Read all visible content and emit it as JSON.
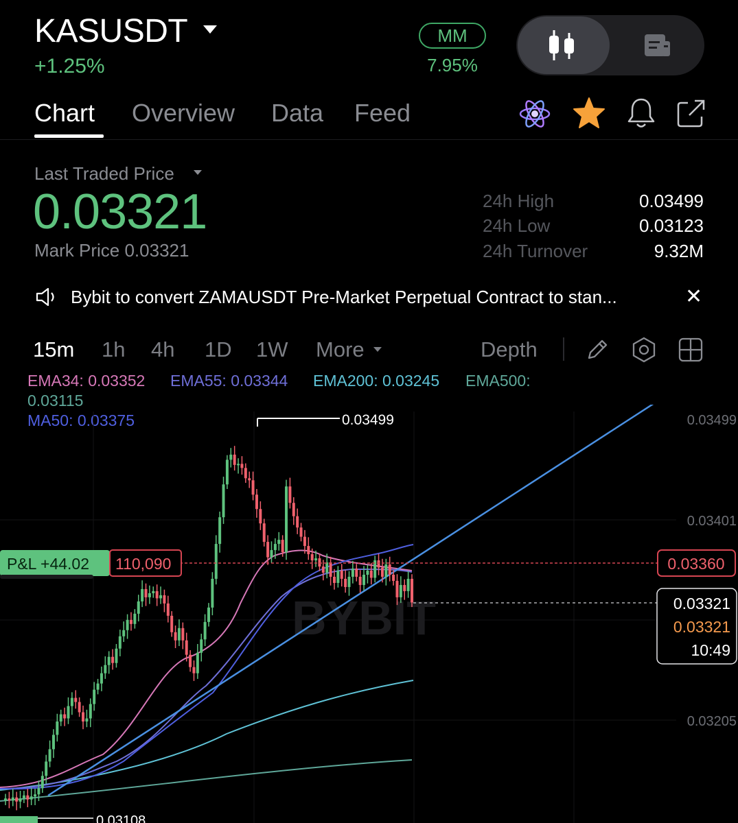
{
  "header": {
    "symbol": "KASUSDT",
    "change": "+1.25%",
    "mm_badge": "MM",
    "mm_value": "7.95%"
  },
  "tabs": [
    {
      "label": "Chart",
      "active": true
    },
    {
      "label": "Overview"
    },
    {
      "label": "Data"
    },
    {
      "label": "Feed"
    }
  ],
  "price": {
    "last_label": "Last Traded Price",
    "last": "0.03321",
    "mark": "Mark Price 0.03321",
    "stats": [
      {
        "label": "24h High",
        "value": "0.03499"
      },
      {
        "label": "24h Low",
        "value": "0.03123"
      },
      {
        "label": "24h Turnover",
        "value": "9.32M"
      }
    ]
  },
  "announcement": {
    "text": "Bybit to convert ZAMAUSDT Pre-Market Perpetual Contract to stan..."
  },
  "intervals": {
    "items": [
      "15m",
      "1h",
      "4h",
      "1D",
      "1W"
    ],
    "more": "More",
    "depth": "Depth"
  },
  "indicators": {
    "ema34": "EMA34: 0.03352",
    "ema55": "EMA55: 0.03344",
    "ema200": "EMA200: 0.03245",
    "ema500_label": "EMA500:",
    "ema500_value": "0.03115",
    "ma50": "MA50: 0.03375"
  },
  "colors": {
    "up": "#5ec27e",
    "down": "#f0616d",
    "ema34": "#d778b8",
    "ema55": "#6f6fd8",
    "ema200": "#5fc2d6",
    "ema500": "#5fa89a",
    "ma50": "#4f5fe0",
    "trendline": "#4a90e2"
  },
  "chart_data": {
    "type": "candlestick",
    "interval": "15m",
    "price_axis_ticks": [
      "0.03499",
      "0.03401",
      "0.03205"
    ],
    "high_marker": "0.03499",
    "low_marker": "0.03108",
    "position": {
      "pnl": "P&L +44.02",
      "size": "110,090",
      "entry_price": "0.03360"
    },
    "current": {
      "last_price": "0.03321",
      "mark_price": "0.03321",
      "countdown": "10:49"
    },
    "watermark": "BYBIT",
    "closes": [
      0.0313,
      0.03128,
      0.03131,
      0.03127,
      0.0313,
      0.03133,
      0.03129,
      0.03132,
      0.03134,
      0.0314,
      0.03152,
      0.03166,
      0.03178,
      0.03192,
      0.03205,
      0.03212,
      0.03208,
      0.0322,
      0.03228,
      0.03224,
      0.03214,
      0.03205,
      0.03208,
      0.03222,
      0.03236,
      0.03242,
      0.03252,
      0.0326,
      0.03268,
      0.03262,
      0.03276,
      0.03288,
      0.03294,
      0.03304,
      0.033,
      0.0331,
      0.03322,
      0.03334,
      0.03326,
      0.0333,
      0.03332,
      0.03325,
      0.03328,
      0.0332,
      0.03308,
      0.03292,
      0.03284,
      0.03296,
      0.03284,
      0.0327,
      0.03258,
      0.03252,
      0.03272,
      0.03285,
      0.03302,
      0.03316,
      0.03344,
      0.03378,
      0.03404,
      0.03436,
      0.0346,
      0.03465,
      0.03455,
      0.03456,
      0.03452,
      0.03442,
      0.0344,
      0.03426,
      0.03412,
      0.03398,
      0.0338,
      0.03365,
      0.03372,
      0.03378,
      0.03382,
      0.0337,
      0.03434,
      0.03418,
      0.03405,
      0.03394,
      0.03385,
      0.03376,
      0.03368,
      0.03362,
      0.03364,
      0.03356,
      0.0335,
      0.0336,
      0.03346,
      0.0334,
      0.03352,
      0.03344,
      0.03336,
      0.03346,
      0.03354,
      0.03346,
      0.03338,
      0.03348,
      0.03352,
      0.03345,
      0.03362,
      0.03355,
      0.03346,
      0.03358,
      0.03348,
      0.03342,
      0.03326,
      0.03338,
      0.03332,
      0.03344,
      0.03321
    ]
  }
}
